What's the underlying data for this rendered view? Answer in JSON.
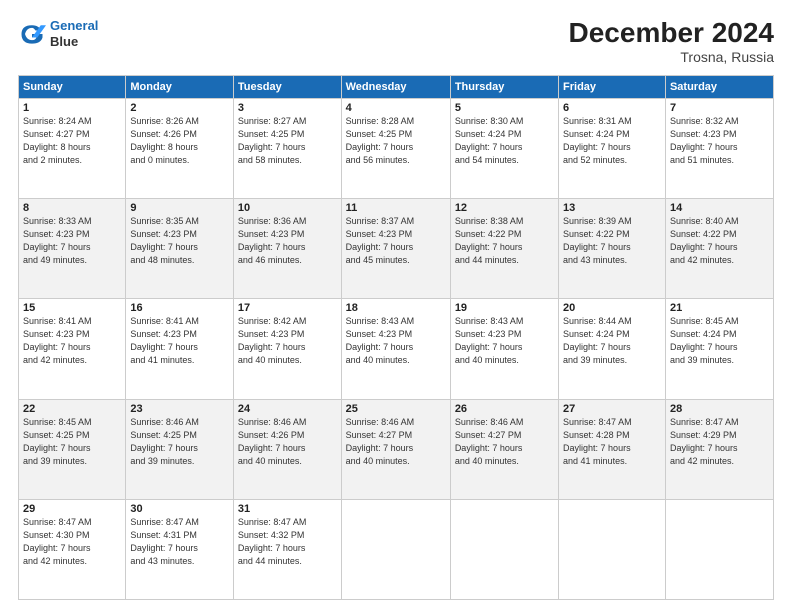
{
  "logo": {
    "line1": "General",
    "line2": "Blue"
  },
  "title": "December 2024",
  "subtitle": "Trosna, Russia",
  "days_of_week": [
    "Sunday",
    "Monday",
    "Tuesday",
    "Wednesday",
    "Thursday",
    "Friday",
    "Saturday"
  ],
  "weeks": [
    [
      {
        "day": "1",
        "info": "Sunrise: 8:24 AM\nSunset: 4:27 PM\nDaylight: 8 hours\nand 2 minutes."
      },
      {
        "day": "2",
        "info": "Sunrise: 8:26 AM\nSunset: 4:26 PM\nDaylight: 8 hours\nand 0 minutes."
      },
      {
        "day": "3",
        "info": "Sunrise: 8:27 AM\nSunset: 4:25 PM\nDaylight: 7 hours\nand 58 minutes."
      },
      {
        "day": "4",
        "info": "Sunrise: 8:28 AM\nSunset: 4:25 PM\nDaylight: 7 hours\nand 56 minutes."
      },
      {
        "day": "5",
        "info": "Sunrise: 8:30 AM\nSunset: 4:24 PM\nDaylight: 7 hours\nand 54 minutes."
      },
      {
        "day": "6",
        "info": "Sunrise: 8:31 AM\nSunset: 4:24 PM\nDaylight: 7 hours\nand 52 minutes."
      },
      {
        "day": "7",
        "info": "Sunrise: 8:32 AM\nSunset: 4:23 PM\nDaylight: 7 hours\nand 51 minutes."
      }
    ],
    [
      {
        "day": "8",
        "info": "Sunrise: 8:33 AM\nSunset: 4:23 PM\nDaylight: 7 hours\nand 49 minutes."
      },
      {
        "day": "9",
        "info": "Sunrise: 8:35 AM\nSunset: 4:23 PM\nDaylight: 7 hours\nand 48 minutes."
      },
      {
        "day": "10",
        "info": "Sunrise: 8:36 AM\nSunset: 4:23 PM\nDaylight: 7 hours\nand 46 minutes."
      },
      {
        "day": "11",
        "info": "Sunrise: 8:37 AM\nSunset: 4:23 PM\nDaylight: 7 hours\nand 45 minutes."
      },
      {
        "day": "12",
        "info": "Sunrise: 8:38 AM\nSunset: 4:22 PM\nDaylight: 7 hours\nand 44 minutes."
      },
      {
        "day": "13",
        "info": "Sunrise: 8:39 AM\nSunset: 4:22 PM\nDaylight: 7 hours\nand 43 minutes."
      },
      {
        "day": "14",
        "info": "Sunrise: 8:40 AM\nSunset: 4:22 PM\nDaylight: 7 hours\nand 42 minutes."
      }
    ],
    [
      {
        "day": "15",
        "info": "Sunrise: 8:41 AM\nSunset: 4:23 PM\nDaylight: 7 hours\nand 42 minutes."
      },
      {
        "day": "16",
        "info": "Sunrise: 8:41 AM\nSunset: 4:23 PM\nDaylight: 7 hours\nand 41 minutes."
      },
      {
        "day": "17",
        "info": "Sunrise: 8:42 AM\nSunset: 4:23 PM\nDaylight: 7 hours\nand 40 minutes."
      },
      {
        "day": "18",
        "info": "Sunrise: 8:43 AM\nSunset: 4:23 PM\nDaylight: 7 hours\nand 40 minutes."
      },
      {
        "day": "19",
        "info": "Sunrise: 8:43 AM\nSunset: 4:23 PM\nDaylight: 7 hours\nand 40 minutes."
      },
      {
        "day": "20",
        "info": "Sunrise: 8:44 AM\nSunset: 4:24 PM\nDaylight: 7 hours\nand 39 minutes."
      },
      {
        "day": "21",
        "info": "Sunrise: 8:45 AM\nSunset: 4:24 PM\nDaylight: 7 hours\nand 39 minutes."
      }
    ],
    [
      {
        "day": "22",
        "info": "Sunrise: 8:45 AM\nSunset: 4:25 PM\nDaylight: 7 hours\nand 39 minutes."
      },
      {
        "day": "23",
        "info": "Sunrise: 8:46 AM\nSunset: 4:25 PM\nDaylight: 7 hours\nand 39 minutes."
      },
      {
        "day": "24",
        "info": "Sunrise: 8:46 AM\nSunset: 4:26 PM\nDaylight: 7 hours\nand 40 minutes."
      },
      {
        "day": "25",
        "info": "Sunrise: 8:46 AM\nSunset: 4:27 PM\nDaylight: 7 hours\nand 40 minutes."
      },
      {
        "day": "26",
        "info": "Sunrise: 8:46 AM\nSunset: 4:27 PM\nDaylight: 7 hours\nand 40 minutes."
      },
      {
        "day": "27",
        "info": "Sunrise: 8:47 AM\nSunset: 4:28 PM\nDaylight: 7 hours\nand 41 minutes."
      },
      {
        "day": "28",
        "info": "Sunrise: 8:47 AM\nSunset: 4:29 PM\nDaylight: 7 hours\nand 42 minutes."
      }
    ],
    [
      {
        "day": "29",
        "info": "Sunrise: 8:47 AM\nSunset: 4:30 PM\nDaylight: 7 hours\nand 42 minutes."
      },
      {
        "day": "30",
        "info": "Sunrise: 8:47 AM\nSunset: 4:31 PM\nDaylight: 7 hours\nand 43 minutes."
      },
      {
        "day": "31",
        "info": "Sunrise: 8:47 AM\nSunset: 4:32 PM\nDaylight: 7 hours\nand 44 minutes."
      },
      null,
      null,
      null,
      null
    ]
  ]
}
